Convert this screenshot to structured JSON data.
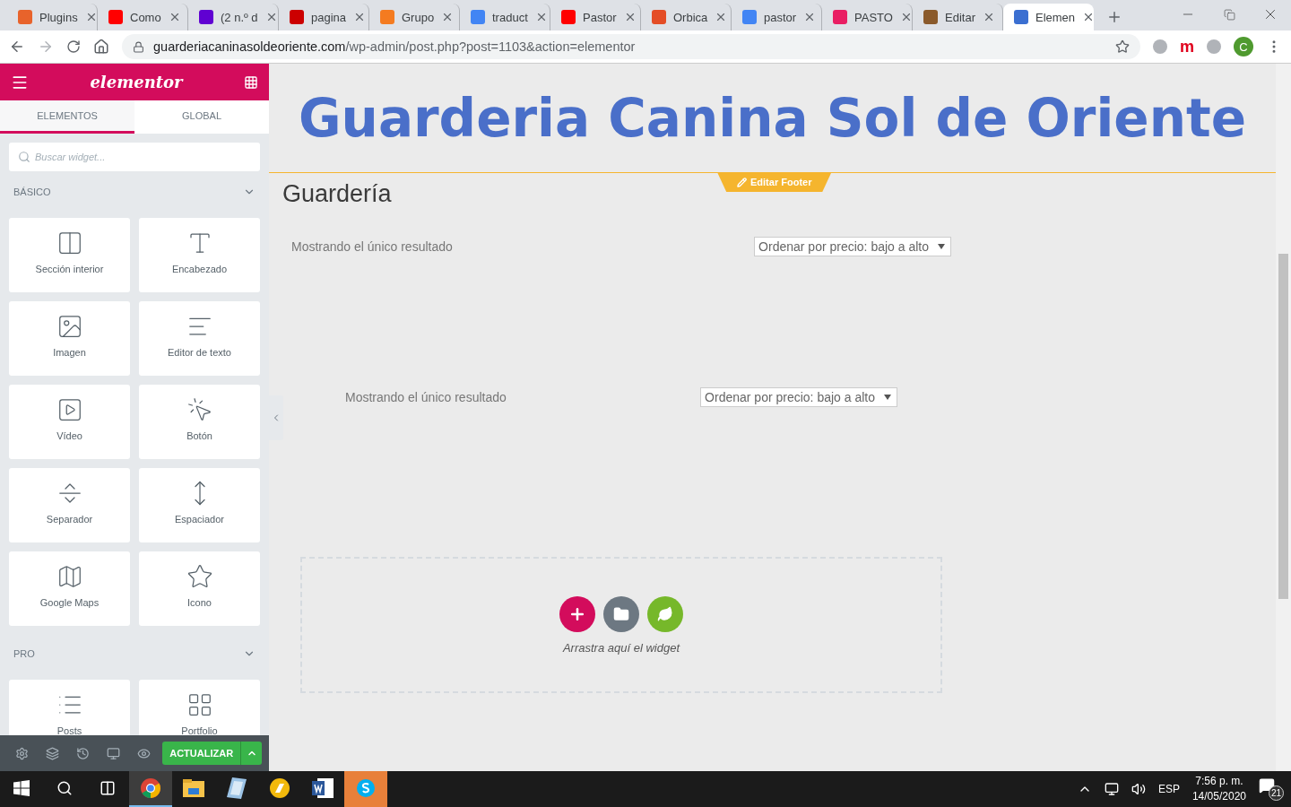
{
  "browser": {
    "tabs": [
      {
        "title": "Plugins",
        "color": "#e8632b",
        "selected": false
      },
      {
        "title": "Como",
        "color": "#ff0000",
        "selected": false
      },
      {
        "title": "(2 n.º d",
        "color": "#6001d2",
        "selected": false
      },
      {
        "title": "pagina",
        "color": "#cc0000",
        "selected": false
      },
      {
        "title": "Grupo",
        "color": "#f47b20",
        "selected": false
      },
      {
        "title": "traduct",
        "color": "#4285f4",
        "selected": false
      },
      {
        "title": "Pastor",
        "color": "#ff0000",
        "selected": false
      },
      {
        "title": "Orbica",
        "color": "#e44d26",
        "selected": false
      },
      {
        "title": "pastor",
        "color": "#4285f4",
        "selected": false
      },
      {
        "title": "PASTO",
        "color": "#e91e63",
        "selected": false
      },
      {
        "title": "Editar",
        "color": "#8a5a2b",
        "selected": false
      },
      {
        "title": "Elemen",
        "color": "#3b6fd1",
        "selected": true
      }
    ],
    "url_host": "guarderiacaninasoldeoriente.com",
    "url_path": "/wp-admin/post.php?post=1103&action=elementor",
    "extension_letter": "m",
    "avatar": "C"
  },
  "panel": {
    "logo": "elementor",
    "tabs": [
      {
        "label": "ELEMENTOS",
        "selected": true
      },
      {
        "label": "GLOBAL",
        "selected": false
      }
    ],
    "search": {
      "placeholder": "Buscar widget..."
    },
    "sections": [
      {
        "title": "BÁSICO",
        "expanded": true,
        "widgets": [
          {
            "kind": "inner-section",
            "label": "Sección interior"
          },
          {
            "kind": "heading",
            "label": "Encabezado"
          },
          {
            "kind": "image",
            "label": "Imagen"
          },
          {
            "kind": "text-editor",
            "label": "Editor de texto"
          },
          {
            "kind": "video",
            "label": "Vídeo"
          },
          {
            "kind": "button",
            "label": "Botón"
          },
          {
            "kind": "divider",
            "label": "Separador"
          },
          {
            "kind": "spacer",
            "label": "Espaciador"
          },
          {
            "kind": "map",
            "label": "Google Maps"
          },
          {
            "kind": "icon",
            "label": "Icono"
          }
        ]
      },
      {
        "title": "PRO",
        "expanded": true,
        "widgets": [
          {
            "kind": "posts",
            "label": "Posts"
          },
          {
            "kind": "portfolio",
            "label": "Portfolio"
          }
        ]
      }
    ],
    "update_button": "ACTUALIZAR"
  },
  "canvas": {
    "site_title": "Guarderia Canina Sol de Oriente",
    "footer_badge": "Editar Footer",
    "page_title": "Guardería",
    "results": [
      {
        "count": "Mostrando el único resultado",
        "sort": "Ordenar por precio: bajo a alto",
        "indent": false
      },
      {
        "count": "Mostrando el único resultado",
        "sort": "Ordenar por precio: bajo a alto",
        "indent": true
      }
    ],
    "drop_hint": "Arrastra aquí el widget"
  },
  "taskbar": {
    "apps": [
      {
        "kind": "chrome",
        "active": true,
        "attention": false
      },
      {
        "kind": "explorer",
        "active": false,
        "attention": false
      },
      {
        "kind": "notepad",
        "active": false,
        "attention": false
      },
      {
        "kind": "filezilla",
        "active": false,
        "attention": false
      },
      {
        "kind": "word",
        "active": false,
        "attention": false
      },
      {
        "kind": "skype",
        "active": false,
        "attention": true
      }
    ],
    "language": "ESP",
    "time": "7:56 p. m.",
    "date": "14/05/2020",
    "notifications": "21"
  }
}
